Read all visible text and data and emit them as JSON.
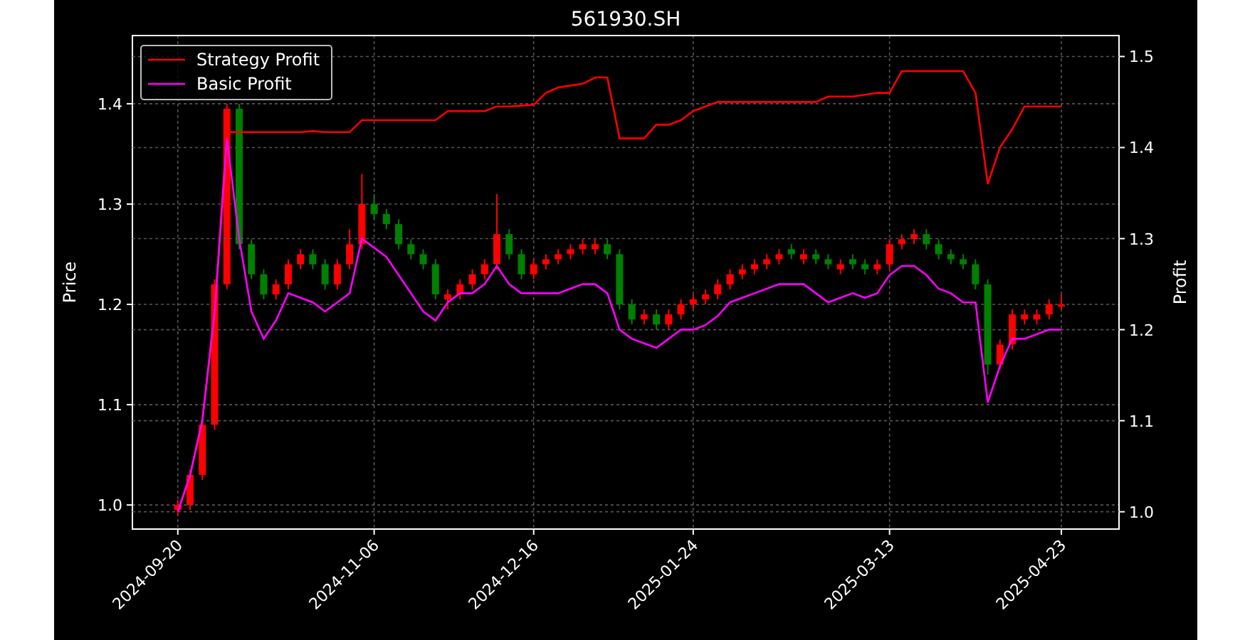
{
  "price_chart": {
    "chart_data": {
      "type": "candlestick",
      "title": "561930.SH",
      "ylabel": "Price",
      "grid": true,
      "categories": [
        "2024-09-20",
        null,
        null,
        null,
        null,
        null,
        null,
        null,
        null,
        null,
        null,
        null,
        null,
        null,
        null,
        null,
        "2024-11-06",
        null,
        null,
        null,
        null,
        null,
        null,
        null,
        null,
        null,
        null,
        null,
        null,
        "2024-12-16",
        null,
        null,
        null,
        null,
        null,
        null,
        null,
        null,
        null,
        null,
        null,
        null,
        "2025-01-24",
        null,
        null,
        null,
        null,
        null,
        null,
        null,
        null,
        null,
        null,
        null,
        null,
        null,
        null,
        null,
        "2025-03-13",
        null,
        null,
        null,
        null,
        null,
        null,
        null,
        null,
        null,
        null,
        null,
        null,
        null,
        "2025-04-23"
      ],
      "ylim": [
        0.976,
        1.468
      ],
      "yticks": [
        {
          "value": 1.0,
          "label": "1.0"
        },
        {
          "value": 1.1,
          "label": "1.1"
        },
        {
          "value": 1.2,
          "label": "1.2"
        },
        {
          "value": 1.3,
          "label": "1.3"
        },
        {
          "value": 1.4,
          "label": "1.4"
        }
      ],
      "ohlc": [
        [
          0.995,
          1.005,
          0.99,
          1.0
        ],
        [
          1.0,
          1.035,
          0.995,
          1.03
        ],
        [
          1.03,
          1.085,
          1.025,
          1.08
        ],
        [
          1.08,
          1.225,
          1.075,
          1.22
        ],
        [
          1.22,
          1.4,
          1.215,
          1.395
        ],
        [
          1.395,
          1.4,
          1.255,
          1.26
        ],
        [
          1.26,
          1.265,
          1.225,
          1.23
        ],
        [
          1.23,
          1.235,
          1.205,
          1.21
        ],
        [
          1.21,
          1.225,
          1.205,
          1.22
        ],
        [
          1.22,
          1.245,
          1.215,
          1.24
        ],
        [
          1.24,
          1.255,
          1.235,
          1.25
        ],
        [
          1.25,
          1.255,
          1.235,
          1.24
        ],
        [
          1.24,
          1.245,
          1.215,
          1.22
        ],
        [
          1.22,
          1.245,
          1.215,
          1.24
        ],
        [
          1.24,
          1.275,
          1.235,
          1.26
        ],
        [
          1.26,
          1.33,
          1.255,
          1.3
        ],
        [
          1.3,
          1.31,
          1.285,
          1.29
        ],
        [
          1.29,
          1.295,
          1.275,
          1.28
        ],
        [
          1.28,
          1.285,
          1.255,
          1.26
        ],
        [
          1.26,
          1.265,
          1.245,
          1.25
        ],
        [
          1.25,
          1.255,
          1.235,
          1.24
        ],
        [
          1.24,
          1.245,
          1.205,
          1.21
        ],
        [
          1.205,
          1.215,
          1.195,
          1.21
        ],
        [
          1.21,
          1.225,
          1.205,
          1.22
        ],
        [
          1.22,
          1.235,
          1.215,
          1.23
        ],
        [
          1.23,
          1.245,
          1.225,
          1.24
        ],
        [
          1.24,
          1.31,
          1.235,
          1.27
        ],
        [
          1.27,
          1.275,
          1.245,
          1.25
        ],
        [
          1.25,
          1.255,
          1.225,
          1.23
        ],
        [
          1.23,
          1.245,
          1.225,
          1.24
        ],
        [
          1.24,
          1.25,
          1.235,
          1.245
        ],
        [
          1.245,
          1.255,
          1.24,
          1.25
        ],
        [
          1.25,
          1.26,
          1.245,
          1.255
        ],
        [
          1.255,
          1.265,
          1.25,
          1.26
        ],
        [
          1.255,
          1.265,
          1.25,
          1.26
        ],
        [
          1.26,
          1.265,
          1.245,
          1.25
        ],
        [
          1.25,
          1.255,
          1.195,
          1.2
        ],
        [
          1.2,
          1.205,
          1.18,
          1.185
        ],
        [
          1.185,
          1.195,
          1.18,
          1.19
        ],
        [
          1.19,
          1.195,
          1.175,
          1.18
        ],
        [
          1.18,
          1.195,
          1.175,
          1.19
        ],
        [
          1.19,
          1.205,
          1.185,
          1.2
        ],
        [
          1.2,
          1.21,
          1.195,
          1.205
        ],
        [
          1.205,
          1.215,
          1.2,
          1.21
        ],
        [
          1.21,
          1.225,
          1.205,
          1.22
        ],
        [
          1.22,
          1.235,
          1.215,
          1.23
        ],
        [
          1.23,
          1.24,
          1.225,
          1.235
        ],
        [
          1.235,
          1.245,
          1.23,
          1.24
        ],
        [
          1.24,
          1.25,
          1.235,
          1.245
        ],
        [
          1.245,
          1.255,
          1.24,
          1.25
        ],
        [
          1.255,
          1.26,
          1.245,
          1.25
        ],
        [
          1.245,
          1.255,
          1.24,
          1.25
        ],
        [
          1.25,
          1.255,
          1.24,
          1.245
        ],
        [
          1.245,
          1.25,
          1.235,
          1.24
        ],
        [
          1.235,
          1.245,
          1.23,
          1.24
        ],
        [
          1.245,
          1.25,
          1.235,
          1.24
        ],
        [
          1.24,
          1.245,
          1.23,
          1.235
        ],
        [
          1.235,
          1.245,
          1.23,
          1.24
        ],
        [
          1.24,
          1.265,
          1.235,
          1.26
        ],
        [
          1.26,
          1.27,
          1.255,
          1.265
        ],
        [
          1.265,
          1.275,
          1.26,
          1.27
        ],
        [
          1.27,
          1.275,
          1.255,
          1.26
        ],
        [
          1.26,
          1.265,
          1.245,
          1.25
        ],
        [
          1.25,
          1.255,
          1.24,
          1.245
        ],
        [
          1.245,
          1.25,
          1.235,
          1.24
        ],
        [
          1.24,
          1.245,
          1.215,
          1.22
        ],
        [
          1.22,
          1.225,
          1.13,
          1.14
        ],
        [
          1.14,
          1.165,
          1.135,
          1.16
        ],
        [
          1.16,
          1.195,
          1.155,
          1.19
        ],
        [
          1.185,
          1.195,
          1.18,
          1.19
        ],
        [
          1.185,
          1.195,
          1.18,
          1.19
        ],
        [
          1.19,
          1.205,
          1.185,
          1.2
        ],
        [
          1.2,
          1.21,
          1.195,
          1.2
        ]
      ]
    }
  },
  "profit_chart": {
    "chart_data": {
      "type": "line",
      "ylabel": "Profit",
      "grid": true,
      "legend": "upper left",
      "categories": [
        null,
        null,
        null,
        null,
        null,
        null,
        null,
        null,
        null,
        null,
        null,
        null,
        null,
        null,
        null,
        null,
        null,
        null,
        null,
        null,
        null,
        null,
        null,
        null,
        null,
        null,
        null,
        null,
        null,
        null,
        null,
        null,
        null,
        null,
        null,
        null,
        null,
        null,
        null,
        null,
        null,
        null,
        null,
        null,
        null,
        null,
        null,
        null,
        null,
        null,
        null,
        null,
        null,
        null,
        null,
        null,
        null,
        null,
        null,
        null,
        null,
        null,
        null,
        null,
        null,
        null,
        null,
        null,
        null,
        null,
        null,
        null,
        null
      ],
      "ylim": [
        0.981,
        1.523
      ],
      "yticks": [
        {
          "value": 1.0,
          "label": "1.0"
        },
        {
          "value": 1.1,
          "label": "1.1"
        },
        {
          "value": 1.2,
          "label": "1.2"
        },
        {
          "value": 1.3,
          "label": "1.3"
        },
        {
          "value": 1.4,
          "label": "1.4"
        },
        {
          "value": 1.5,
          "label": "1.5"
        }
      ],
      "series": [
        {
          "name": "Strategy Profit",
          "color": "#ff0000",
          "values": [
            1.0,
            1.04,
            1.1,
            1.22,
            1.417,
            1.417,
            1.417,
            1.417,
            1.417,
            1.417,
            1.417,
            1.418,
            1.417,
            1.417,
            1.417,
            1.43,
            1.43,
            1.43,
            1.43,
            1.43,
            1.43,
            1.43,
            1.44,
            1.44,
            1.44,
            1.44,
            1.445,
            1.445,
            1.446,
            1.447,
            1.46,
            1.466,
            1.468,
            1.47,
            1.477,
            1.477,
            1.41,
            1.41,
            1.41,
            1.425,
            1.425,
            1.43,
            1.44,
            1.445,
            1.45,
            1.45,
            1.45,
            1.45,
            1.45,
            1.45,
            1.45,
            1.45,
            1.45,
            1.456,
            1.456,
            1.456,
            1.458,
            1.46,
            1.46,
            1.484,
            1.484,
            1.484,
            1.484,
            1.484,
            1.484,
            1.46,
            1.36,
            1.4,
            1.42,
            1.445,
            1.445,
            1.445,
            1.445
          ]
        },
        {
          "name": "Basic Profit",
          "color": "#ff00ff",
          "values": [
            1.0,
            1.04,
            1.1,
            1.22,
            1.41,
            1.3,
            1.22,
            1.19,
            1.21,
            1.24,
            1.235,
            1.23,
            1.22,
            1.23,
            1.24,
            1.3,
            1.29,
            1.28,
            1.26,
            1.24,
            1.22,
            1.21,
            1.23,
            1.24,
            1.24,
            1.25,
            1.27,
            1.25,
            1.24,
            1.24,
            1.24,
            1.24,
            1.245,
            1.25,
            1.25,
            1.24,
            1.2,
            1.19,
            1.185,
            1.18,
            1.19,
            1.2,
            1.2,
            1.205,
            1.215,
            1.23,
            1.235,
            1.24,
            1.245,
            1.25,
            1.25,
            1.25,
            1.24,
            1.23,
            1.235,
            1.24,
            1.235,
            1.24,
            1.26,
            1.27,
            1.27,
            1.26,
            1.245,
            1.24,
            1.23,
            1.23,
            1.12,
            1.16,
            1.19,
            1.19,
            1.195,
            1.2,
            1.2
          ]
        }
      ]
    }
  }
}
